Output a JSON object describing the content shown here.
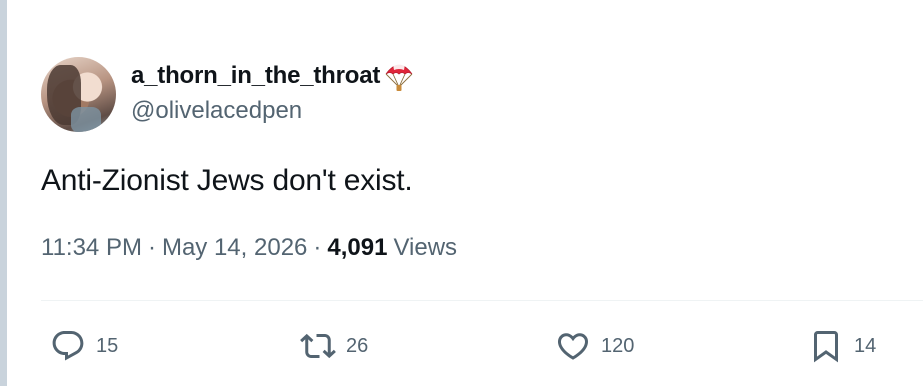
{
  "author": {
    "display_name": "a_thorn_in_the_throat",
    "handle": "@olivelacedpen",
    "name_emoji": "parachute-icon"
  },
  "tweet": {
    "text": "Anti-Zionist Jews don't exist.",
    "time": "11:34 PM",
    "date": "May 14, 2026",
    "views_count": "4,091",
    "views_label": "Views"
  },
  "actions": {
    "reply_count": "15",
    "retweet_count": "26",
    "like_count": "120",
    "bookmark_count": "14"
  },
  "colors": {
    "text_primary": "#0f1419",
    "text_secondary": "#536471",
    "divider": "#eff3f4",
    "parachute_red": "#e0263a"
  }
}
